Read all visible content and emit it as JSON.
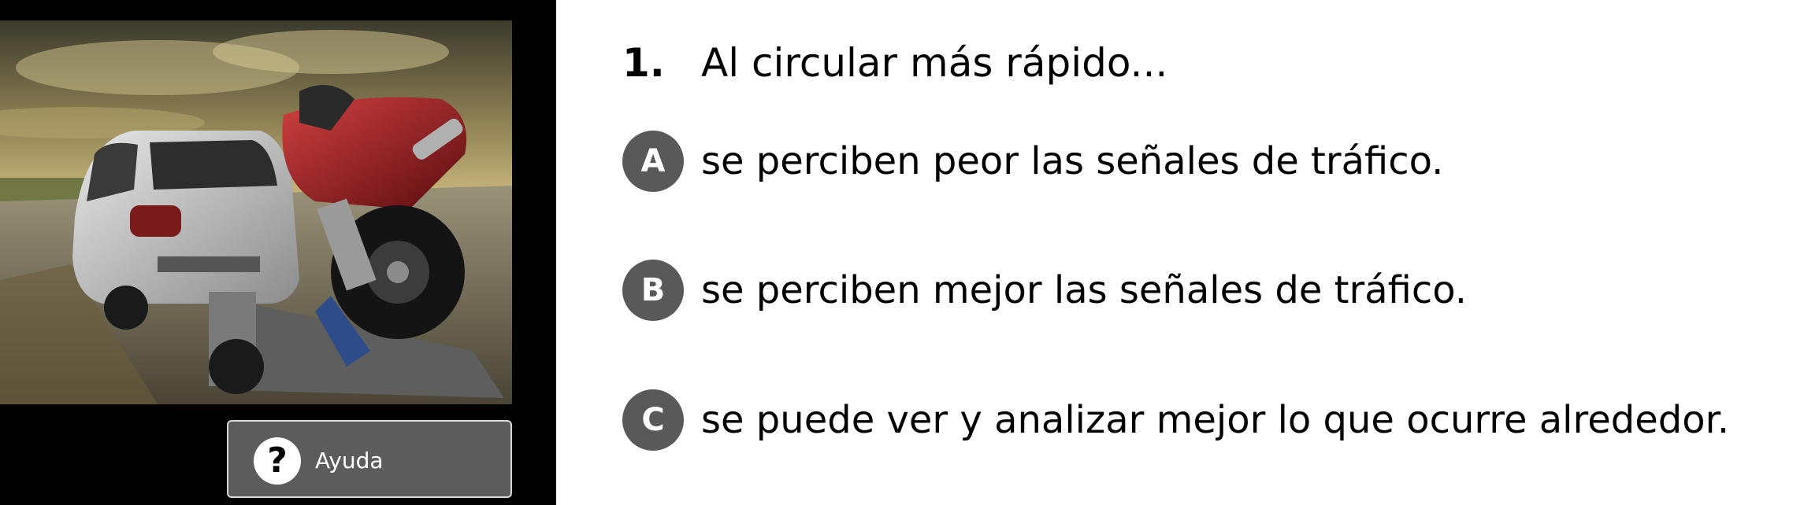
{
  "question": {
    "number": "1.",
    "text": "Al circular más rápido..."
  },
  "options": [
    {
      "letter": "A",
      "text": "se perciben peor las señales de tráfico."
    },
    {
      "letter": "B",
      "text": "se perciben mejor las señales de tráfico."
    },
    {
      "letter": "C",
      "text": "se puede ver y analizar mejor lo que ocurre alrededor."
    }
  ],
  "help": {
    "label": "Ayuda",
    "icon": "question-mark-icon"
  },
  "colors": {
    "panel_background": "#000000",
    "badge": "#595959",
    "help_button": "#5c5c5c"
  }
}
